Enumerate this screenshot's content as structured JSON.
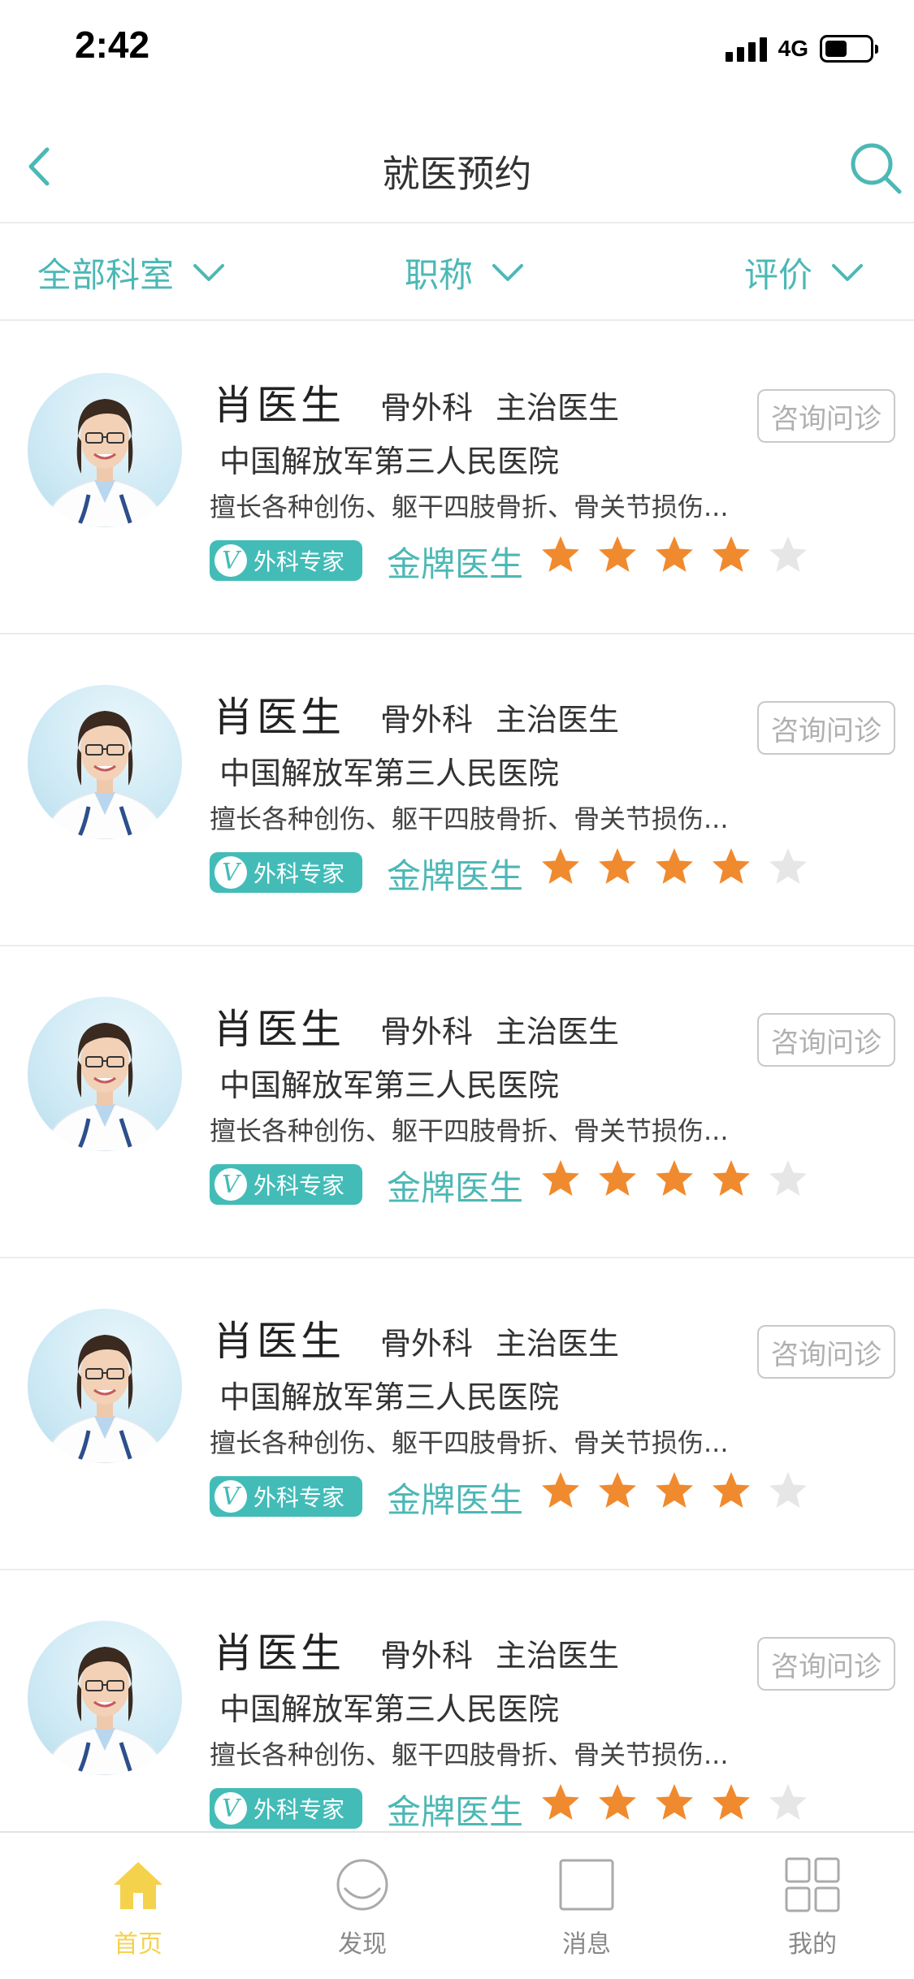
{
  "status_bar": {
    "time": "2:42",
    "network": "4G"
  },
  "nav": {
    "title": "就医预约",
    "back_icon": "chevron-left-icon",
    "search_icon": "search-icon"
  },
  "filters": [
    {
      "label": "全部科室"
    },
    {
      "label": "职称"
    },
    {
      "label": "评价"
    }
  ],
  "doctors": [
    {
      "name": "肖医生",
      "department": "骨外科",
      "title": "主治医生",
      "hospital": "中国解放军第三人民医院",
      "specialty": "擅长各种创伤、躯干四肢骨折、骨关节损伤...",
      "badge": "外科专家",
      "level": "金牌医生",
      "rating": 4,
      "rating_max": 5,
      "action": "咨询问诊"
    },
    {
      "name": "肖医生",
      "department": "骨外科",
      "title": "主治医生",
      "hospital": "中国解放军第三人民医院",
      "specialty": "擅长各种创伤、躯干四肢骨折、骨关节损伤...",
      "badge": "外科专家",
      "level": "金牌医生",
      "rating": 4,
      "rating_max": 5,
      "action": "咨询问诊"
    },
    {
      "name": "肖医生",
      "department": "骨外科",
      "title": "主治医生",
      "hospital": "中国解放军第三人民医院",
      "specialty": "擅长各种创伤、躯干四肢骨折、骨关节损伤...",
      "badge": "外科专家",
      "level": "金牌医生",
      "rating": 4,
      "rating_max": 5,
      "action": "咨询问诊"
    },
    {
      "name": "肖医生",
      "department": "骨外科",
      "title": "主治医生",
      "hospital": "中国解放军第三人民医院",
      "specialty": "擅长各种创伤、躯干四肢骨折、骨关节损伤...",
      "badge": "外科专家",
      "level": "金牌医生",
      "rating": 4,
      "rating_max": 5,
      "action": "咨询问诊"
    },
    {
      "name": "肖医生",
      "department": "骨外科",
      "title": "主治医生",
      "hospital": "中国解放军第三人民医院",
      "specialty": "擅长各种创伤、躯干四肢骨折、骨关节损伤...",
      "badge": "外科专家",
      "level": "金牌医生",
      "rating": 4,
      "rating_max": 5,
      "action": "咨询问诊"
    }
  ],
  "tabbar": [
    {
      "label": "首页",
      "icon": "home-icon",
      "active": true
    },
    {
      "label": "发现",
      "icon": "discover-icon",
      "active": false
    },
    {
      "label": "消息",
      "icon": "message-icon",
      "active": false
    },
    {
      "label": "我的",
      "icon": "grid-icon",
      "active": false
    }
  ],
  "colors": {
    "accent": "#4cb8b6",
    "badge": "#43bcb8",
    "star_on": "#f08a2e",
    "star_off": "#e6e6e6",
    "tab_active": "#f5d24c"
  }
}
